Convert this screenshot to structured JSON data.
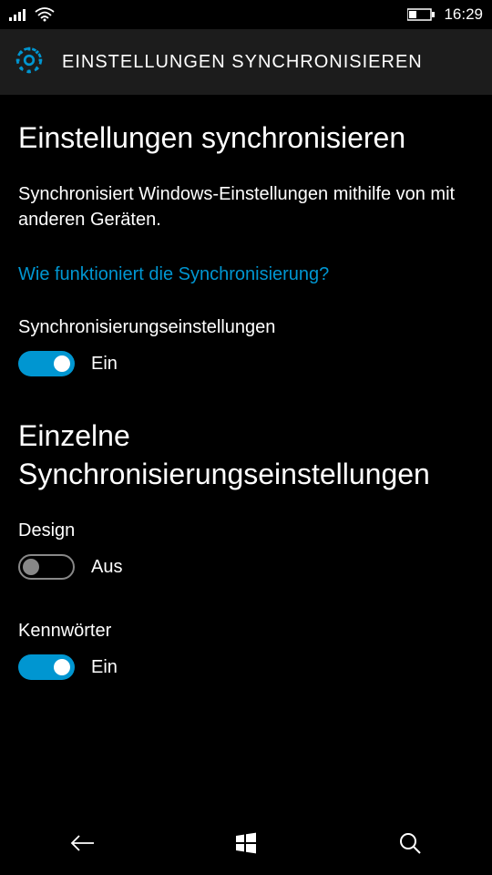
{
  "statusBar": {
    "time": "16:29"
  },
  "header": {
    "title": "EINSTELLUNGEN SYNCHRONISIEREN"
  },
  "main": {
    "pageTitle": "Einstellungen synchronisieren",
    "description": "Synchronisiert Windows-Einstellungen mithilfe von mit anderen Geräten.",
    "helpLink": "Wie funktioniert die Synchronisierung?",
    "syncSetting": {
      "label": "Synchronisierungseinstellungen",
      "state": "Ein",
      "on": true
    },
    "individualTitle": "Einzelne Synchronisierungseinstellungen",
    "design": {
      "label": "Design",
      "state": "Aus",
      "on": false
    },
    "passwords": {
      "label": "Kennwörter",
      "state": "Ein",
      "on": true
    }
  }
}
